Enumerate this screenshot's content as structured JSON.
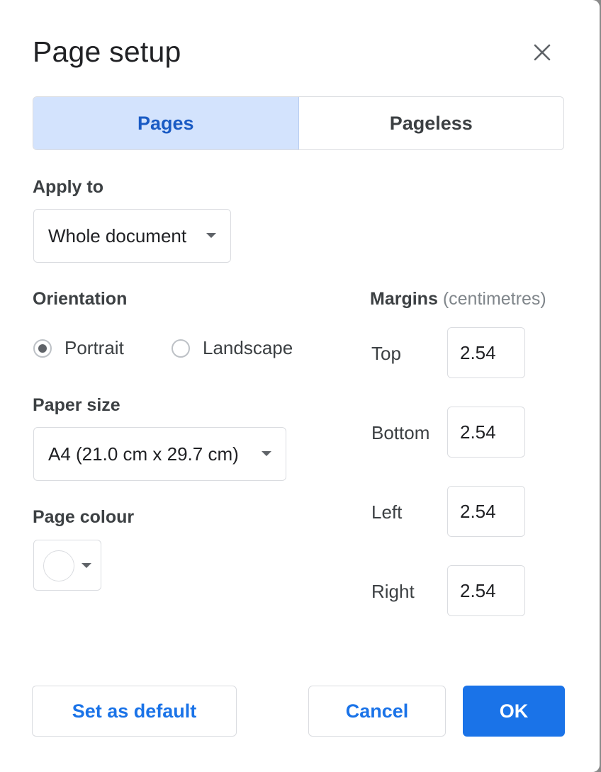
{
  "dialog": {
    "title": "Page setup"
  },
  "tabs": [
    {
      "label": "Pages",
      "active": true
    },
    {
      "label": "Pageless",
      "active": false
    }
  ],
  "apply_to": {
    "label": "Apply to",
    "value": "Whole document"
  },
  "orientation": {
    "label": "Orientation",
    "options": [
      {
        "label": "Portrait",
        "selected": true
      },
      {
        "label": "Landscape",
        "selected": false
      }
    ]
  },
  "paper_size": {
    "label": "Paper size",
    "value": "A4 (21.0 cm x 29.7 cm)"
  },
  "page_colour": {
    "label": "Page colour",
    "value_color": "#ffffff"
  },
  "margins": {
    "label": "Margins",
    "unit": "(centimetres)",
    "fields": [
      {
        "label": "Top",
        "value": "2.54"
      },
      {
        "label": "Bottom",
        "value": "2.54"
      },
      {
        "label": "Left",
        "value": "2.54"
      },
      {
        "label": "Right",
        "value": "2.54"
      }
    ]
  },
  "buttons": {
    "set_default": "Set as default",
    "cancel": "Cancel",
    "ok": "OK"
  },
  "colors": {
    "accent": "#1a73e8",
    "tab_active_bg": "#d3e3fd",
    "tab_active_text": "#1a5bc4",
    "border": "#dadce0"
  },
  "icons": {
    "close": "close-icon",
    "dropdown": "chevron-down-icon",
    "radio": "radio-icon"
  }
}
